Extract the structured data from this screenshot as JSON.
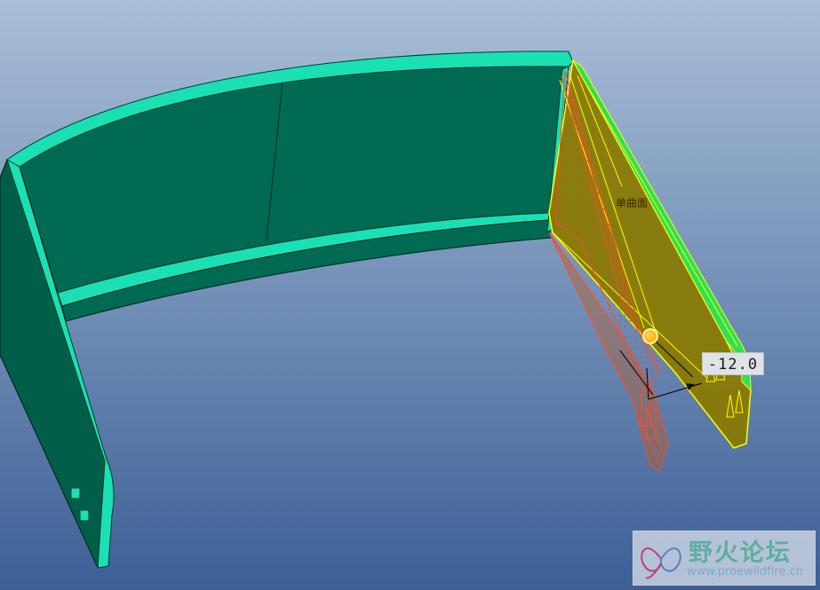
{
  "viewport": {
    "background_top": "#a9bfd7",
    "background_bottom": "#3d5f96",
    "part_face_color": "#006a52",
    "part_edge_color": "#1be0b4",
    "selection_fill_color": "#8a7a00",
    "selection_edge_color": "#ffff00",
    "preview_edge_color": "#ff4a2a"
  },
  "annotations": {
    "surface_label": "单曲面",
    "dimension_value": "-12.0"
  },
  "watermark": {
    "title": "野火论坛",
    "url": "www.proewildfire.cn"
  }
}
